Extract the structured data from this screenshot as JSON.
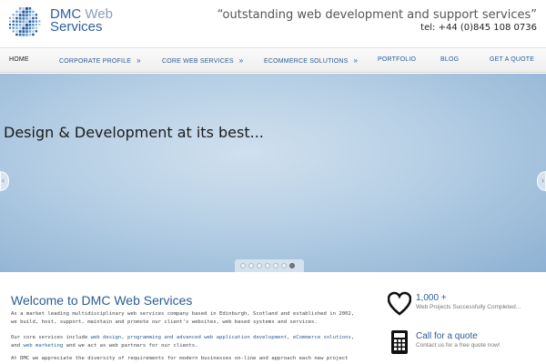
{
  "header": {
    "logo": {
      "line1_main": "DMC",
      "line1_accent": "Web",
      "line2": "Services"
    },
    "tagline": "“outstanding web development and support services”",
    "phone": "tel: +44 (0)845 108 0736"
  },
  "nav": {
    "items": [
      {
        "label": "HOME",
        "active": true,
        "has_chevron": false
      },
      {
        "label": "CORPORATE PROFILE",
        "active": false,
        "has_chevron": true
      },
      {
        "label": "CORE WEB SERVICES",
        "active": false,
        "has_chevron": true
      },
      {
        "label": "eCOMMERCE SOLUTIONS",
        "active": false,
        "has_chevron": true
      },
      {
        "label": "PORTFOLIO",
        "active": false,
        "has_chevron": false
      },
      {
        "label": "BLOG",
        "active": false,
        "has_chevron": false
      },
      {
        "label": "GET A QUOTE",
        "active": false,
        "has_chevron": false
      }
    ],
    "chevron": "»"
  },
  "hero": {
    "title": "Design & Development at its best...",
    "slide_count": 7,
    "active_slide": 6,
    "prev_glyph": "‹",
    "next_glyph": "›"
  },
  "content": {
    "heading": "Welcome to DMC Web Services",
    "p1": "As a market leading multidisciplinary web services company based in Edinburgh, Scotland and established in 2002, we build, host, support, maintain and promote our client's websites, web based systems and services.",
    "p2": {
      "t1": "Our core services include ",
      "l1": "web design",
      "t2": ", ",
      "l2": "programming and advanced web application development",
      "t3": ", ",
      "l3": "eCommerce solutions",
      "t4": ", and ",
      "l4": "web marketing",
      "t5": " and we act as web partners for our clients."
    },
    "p3": "At DMC we appreciate the diversity of requirements for modern businesses on-line and approach each new project"
  },
  "widgets": {
    "projects": {
      "title": "1,000 +",
      "subtitle": "Web Projects Successfully Completed..."
    },
    "quote": {
      "title": "Call for a quote",
      "subtitle": "Contact us for a free quote now!"
    }
  },
  "colors": {
    "brand_blue": "#2b5d96",
    "hero_blue": "#9cbcd9"
  }
}
